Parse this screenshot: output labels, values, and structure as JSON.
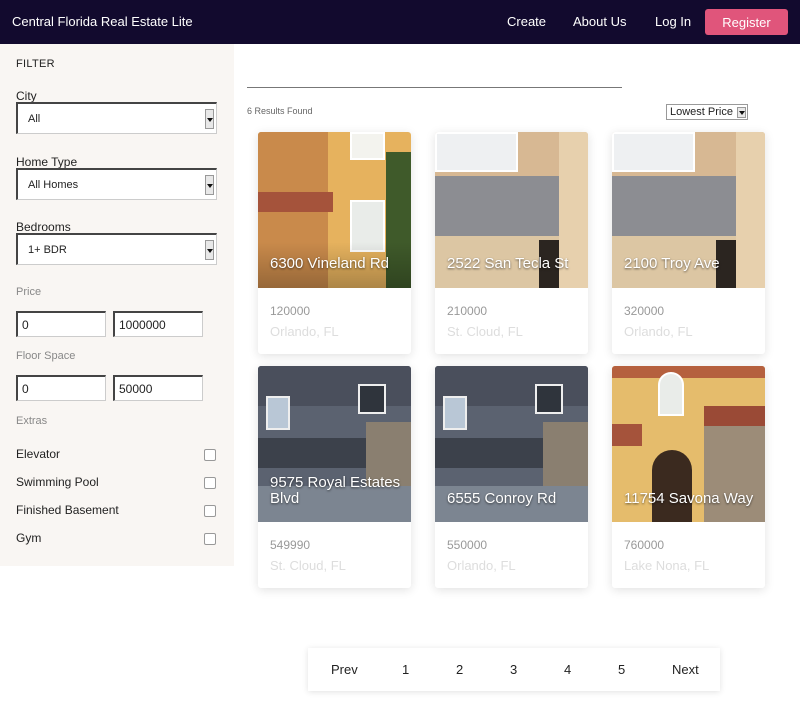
{
  "header": {
    "brand": "Central Florida Real Estate Lite",
    "nav": {
      "create": "Create",
      "about": "About Us",
      "login": "Log In",
      "register": "Register"
    },
    "bg_color": "#120a2e",
    "accent_color": "#e0557b"
  },
  "sidebar": {
    "title": "FILTER",
    "city": {
      "label": "City",
      "value": "All"
    },
    "home_type": {
      "label": "Home Type",
      "value": "All Homes"
    },
    "bedrooms": {
      "label": "Bedrooms",
      "value": "1+ BDR"
    },
    "price": {
      "label": "Price",
      "min": "0",
      "max": "1000000"
    },
    "floor_space": {
      "label": "Floor Space",
      "min": "0",
      "max": "50000"
    },
    "extras": {
      "label": "Extras",
      "items": [
        {
          "label": "Elevator",
          "checked": false
        },
        {
          "label": "Swimming Pool",
          "checked": false
        },
        {
          "label": "Finished Basement",
          "checked": false
        },
        {
          "label": "Gym",
          "checked": false
        }
      ]
    }
  },
  "main": {
    "results_text": "6 Results Found",
    "sort_value": "Lowest Price",
    "listings": [
      {
        "address": "6300 Vineland Rd",
        "price": "120000",
        "city": "Orlando, FL"
      },
      {
        "address": "2522 San Tecla St",
        "price": "210000",
        "city": "St. Cloud, FL"
      },
      {
        "address": "2100 Troy Ave",
        "price": "320000",
        "city": "Orlando, FL"
      },
      {
        "address": "9575 Royal Estates Blvd",
        "price": "549990",
        "city": "St. Cloud, FL"
      },
      {
        "address": "6555 Conroy Rd",
        "price": "550000",
        "city": "Orlando, FL"
      },
      {
        "address": "11754 Savona Way",
        "price": "760000",
        "city": "Lake Nona, FL"
      }
    ]
  },
  "pagination": {
    "prev": "Prev",
    "pages": [
      "1",
      "2",
      "3",
      "4",
      "5"
    ],
    "next": "Next"
  }
}
